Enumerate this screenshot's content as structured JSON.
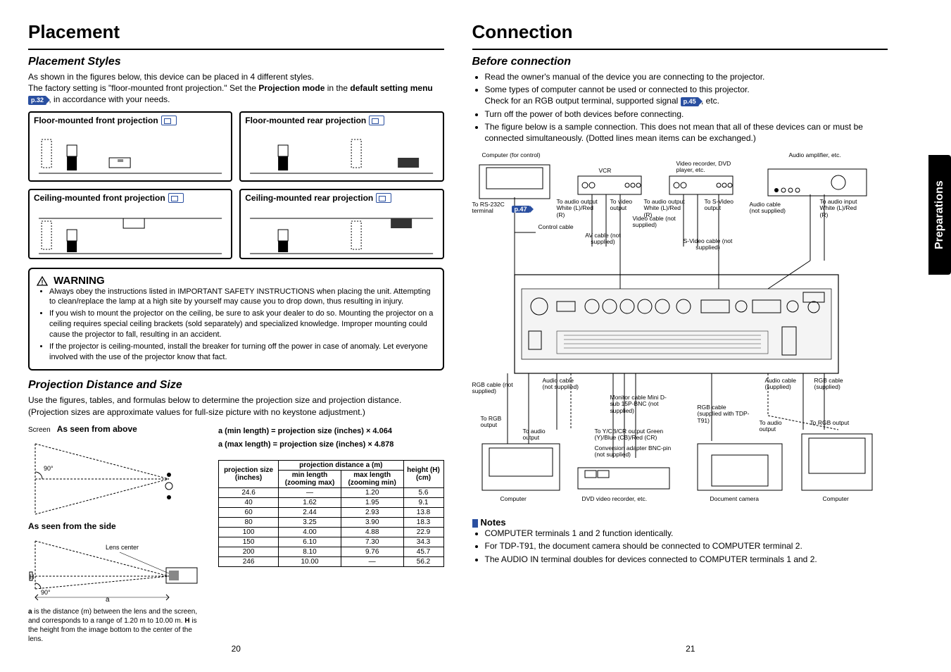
{
  "left": {
    "title": "Placement",
    "styles_heading": "Placement Styles",
    "styles_p1": "As shown in the figures below, this device can be placed in 4 different styles.",
    "styles_p2a": "The factory setting is \"floor-mounted front projection.\" Set the ",
    "styles_p2b": "Projection mode",
    "styles_p2c": " in the ",
    "styles_p2d": "default setting menu ",
    "styles_p2_ref": "p.32",
    "styles_p2e": " , in accordance with your needs.",
    "box_ff": "Floor-mounted front projection",
    "box_fr": "Floor-mounted rear projection",
    "box_cf": "Ceiling-mounted front projection",
    "box_cr": "Ceiling-mounted rear projection",
    "warn_label": "WARNING",
    "warn1": "Always obey the instructions listed in IMPORTANT SAFETY INSTRUCTIONS when placing the unit. Attempting to clean/replace the lamp at a high site by yourself may cause you to drop down, thus resulting in injury.",
    "warn2": "If you wish to mount the projector on the ceiling, be sure to ask your dealer to do so. Mounting the projector on a ceiling requires special ceiling brackets (sold separately) and specialized knowledge. Improper mounting could cause the projector to fall, resulting in an accident.",
    "warn3": "If the projector is ceiling-mounted, install the breaker for turning off the power in case of anomaly. Let everyone involved with the use of the projector know that fact.",
    "pd_heading": "Projection Distance and Size",
    "pd_p1": "Use the figures, tables, and formulas below to determine the projection size and projection distance. (Projection sizes are approximate values for full-size picture with no keystone adjustment.)",
    "as_above": "As seen from above",
    "as_side": "As seen from the side",
    "screen_lbl": "Screen",
    "lens_center": "Lens center",
    "ninety": "90°",
    "diag_a": "a",
    "diag_h": "H",
    "diag_caption_a": "a",
    "diag_caption_h": "H",
    "diag_caption": " is the distance (m) between the lens and the screen, and corresponds to a range of 1.20 m to 10.00 m.  is the height from the image bottom to the center of the lens.",
    "diag_caption_part1": " is the distance (m) between the lens and the screen, and corresponds to a range of 1.20 m to 10.00 m. ",
    "diag_caption_part2": " is the height from the image bottom to the center of the lens.",
    "formula_min": "a (min length) = projection size (inches) × 4.064",
    "formula_max": "a (max length) = projection size (inches) × 4.878",
    "table": {
      "hdr_size": "projection size (inches)",
      "hdr_dist": "projection distance a (m)",
      "hdr_min": "min length (zooming max)",
      "hdr_max": "max length (zooming min)",
      "hdr_h": "height (H) (cm)"
    },
    "page_num": "20"
  },
  "chart_data": {
    "type": "table",
    "columns": [
      "projection size (inches)",
      "min length (zooming max)",
      "max length (zooming min)",
      "height (H) (cm)"
    ],
    "rows": [
      [
        "24.6",
        "—",
        "1.20",
        "5.6"
      ],
      [
        "40",
        "1.62",
        "1.95",
        "9.1"
      ],
      [
        "60",
        "2.44",
        "2.93",
        "13.8"
      ],
      [
        "80",
        "3.25",
        "3.90",
        "18.3"
      ],
      [
        "100",
        "4.00",
        "4.88",
        "22.9"
      ],
      [
        "150",
        "6.10",
        "7.30",
        "34.3"
      ],
      [
        "200",
        "8.10",
        "9.76",
        "45.7"
      ],
      [
        "246",
        "10.00",
        "—",
        "56.2"
      ]
    ]
  },
  "right": {
    "title": "Connection",
    "before_heading": "Before connection",
    "b1": "Read the owner's manual of the device you are connecting to the projector.",
    "b2a": "Some types of computer cannot be used or connected to this projector.",
    "b2b": "Check for an RGB output terminal, supported signal ",
    "b2_ref": "p.45",
    "b2c": " , etc.",
    "b3": "Turn off the power of both devices before connecting.",
    "b4": "The figure below is a sample connection. This does not mean that all of these devices can or must be connected simultaneously. (Dotted lines mean items can be exchanged.)",
    "diag": {
      "comp_control": "Computer (for control)",
      "vcr": "VCR",
      "video_dvd": "Video recorder, DVD player, etc.",
      "audio_amp": "Audio amplifier, etc.",
      "rs232": "To RS-232C terminal",
      "p47": "p.47",
      "to_audio_out": "To audio output White (L)/Red (R)",
      "to_audio_in": "To audio input White (L)/Red (R)",
      "to_video_out": "To video output",
      "to_svideo_out": "To S-Video output",
      "audio_cable_ns": "Audio cable (not supplied)",
      "audio_cable_s": "Audio cable (supplied)",
      "control_cable": "Control cable",
      "av_cable_ns": "AV cable (not supplied)",
      "video_cable_ns": "Video cable (not supplied)",
      "svideo_cable_ns": "S-Video cable (not supplied)",
      "rgb_cable_ns": "RGB cable (not supplied)",
      "rgb_cable_s": "RGB cable (supplied)",
      "monitor_cable": "Monitor cable Mini D-sub 15P-BNC (not supplied)",
      "rgb_cable_t91": "RGB cable (supplied with TDP-T91)",
      "to_rgb_out": "To RGB output",
      "to_audio_out2": "To audio output",
      "to_ycbcr": "To Y/CB/CR output Green (Y)/Blue (CB)/Red (CR)",
      "conv_adapter": "Conversion adapter BNC-pin (not supplied)",
      "computer": "Computer",
      "dvd_rec": "DVD video recorder, etc.",
      "doc_cam": "Document camera"
    },
    "notes_head": "Notes",
    "n1": "COMPUTER terminals 1 and 2 function identically.",
    "n2": "For TDP-T91, the document camera should be connected to COMPUTER terminal 2.",
    "n3": "The AUDIO IN terminal doubles for devices connected to COMPUTER terminals 1 and 2.",
    "page_num": "21",
    "side_tab": "Preparations"
  }
}
